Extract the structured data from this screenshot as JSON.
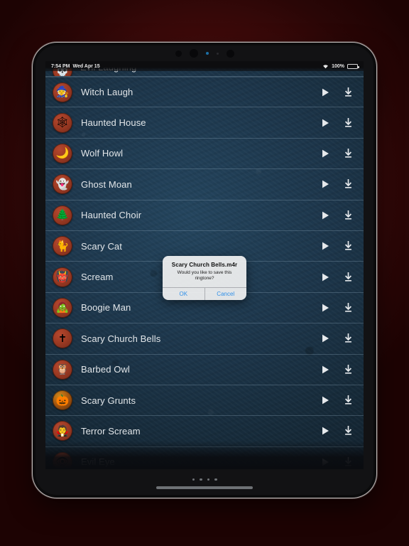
{
  "status_bar": {
    "time": "7:54 PM",
    "date": "Wed Apr 15",
    "battery_percent": "100%",
    "wifi_icon": "wifi-icon",
    "battery_icon": "battery-full-icon"
  },
  "clipped_row": {
    "title": "Evil Laughing",
    "icon": "skull-icon",
    "glyph": "💀"
  },
  "list": {
    "play_icon": "play-icon",
    "download_icon": "download-icon",
    "items": [
      {
        "title": "Witch Laugh",
        "icon": "witch-icon",
        "glyph": "🧙",
        "style": "red"
      },
      {
        "title": "Haunted House",
        "icon": "spiderweb-icon",
        "glyph": "🕸",
        "style": "red"
      },
      {
        "title": "Wolf Howl",
        "icon": "wolf-moon-icon",
        "glyph": "🌙",
        "style": "red"
      },
      {
        "title": "Ghost Moan",
        "icon": "ghost-icon",
        "glyph": "👻",
        "style": "red"
      },
      {
        "title": "Haunted Choir",
        "icon": "dead-tree-icon",
        "glyph": "🌲",
        "style": "red"
      },
      {
        "title": "Scary Cat",
        "icon": "black-cat-icon",
        "glyph": "🐈",
        "style": "red"
      },
      {
        "title": "Scream",
        "icon": "devil-icon",
        "glyph": "👹",
        "style": "red"
      },
      {
        "title": "Boogie Man",
        "icon": "boogie-man-icon",
        "glyph": "🧟",
        "style": "red"
      },
      {
        "title": "Scary Church Bells",
        "icon": "grave-cross-icon",
        "glyph": "✝",
        "style": "red"
      },
      {
        "title": "Barbed Owl",
        "icon": "owl-icon",
        "glyph": "🦉",
        "style": "red"
      },
      {
        "title": "Scary Grunts",
        "icon": "pumpkin-icon",
        "glyph": "🎃",
        "style": "pumpkin"
      },
      {
        "title": "Terror Scream",
        "icon": "zombie-icon",
        "glyph": "🧛",
        "style": "red"
      },
      {
        "title": "Evil Eye",
        "icon": "eye-icon",
        "glyph": "👁",
        "style": "red"
      }
    ]
  },
  "alert": {
    "title": "Scary Church Bells.m4r",
    "message": "Would you like to save this ringtone?",
    "ok_label": "OK",
    "cancel_label": "Cancel"
  },
  "device": {
    "page_dot_count": 4,
    "home_indicator": "home-indicator"
  },
  "colors": {
    "accent_blue": "#2f8fe8",
    "screen_bg": "#1c354a",
    "thumb_red": "#9c3a23",
    "backdrop_red": "#5a1010"
  }
}
